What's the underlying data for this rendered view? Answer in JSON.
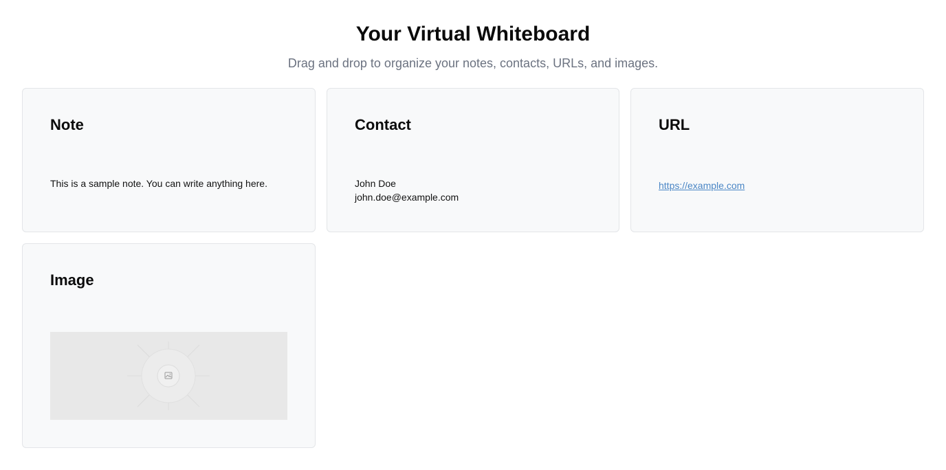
{
  "header": {
    "title": "Your Virtual Whiteboard",
    "subtitle": "Drag and drop to organize your notes, contacts, URLs, and images."
  },
  "cards": {
    "note": {
      "title": "Note",
      "text": "This is a sample note. You can write anything here."
    },
    "contact": {
      "title": "Contact",
      "name": "John Doe",
      "email": "john.doe@example.com"
    },
    "url": {
      "title": "URL",
      "link_text": "https://example.com"
    },
    "image": {
      "title": "Image",
      "icon": "image-placeholder-icon"
    }
  },
  "colors": {
    "card_background": "#f8f9fa",
    "card_border": "#e3e5e8",
    "link": "#4a86c5",
    "subtitle": "#6b7280",
    "image_placeholder": "#e8e8e8"
  }
}
